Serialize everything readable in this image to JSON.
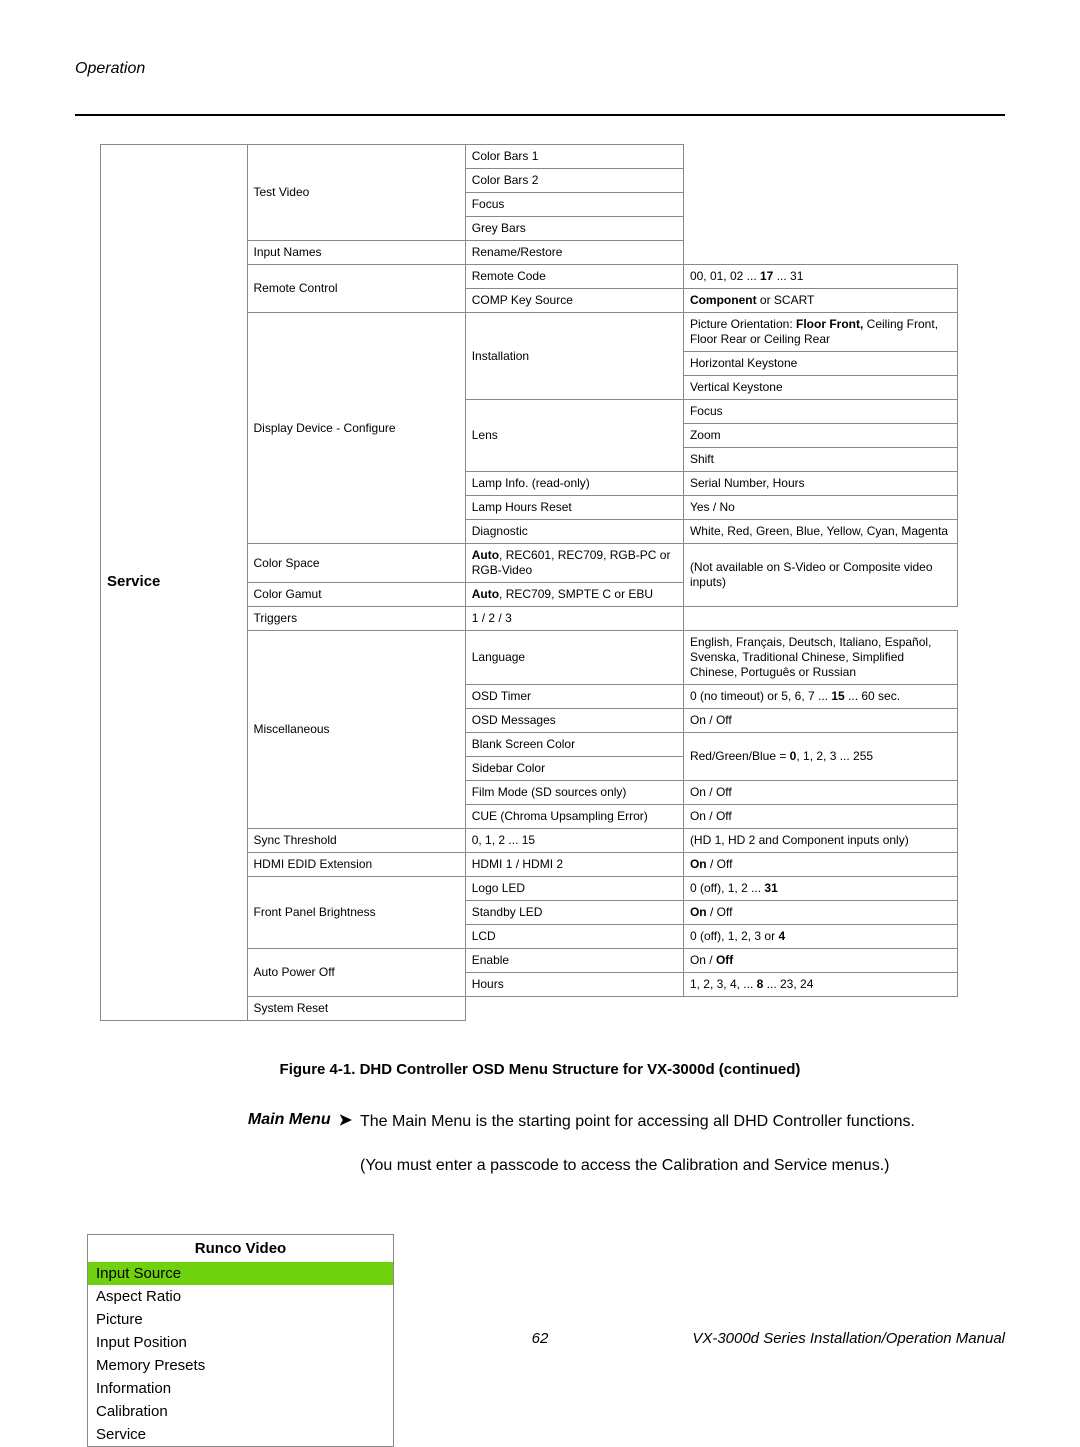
{
  "header": "Operation",
  "section": "Service",
  "table": {
    "test_video": {
      "label": "Test Video",
      "items": [
        "Color Bars 1",
        "Color Bars 2",
        "Focus",
        "Grey Bars"
      ]
    },
    "input_names": {
      "label": "Input Names",
      "val": "Rename/Restore"
    },
    "remote_control": {
      "label": "Remote Control",
      "remote_code": "Remote Code",
      "remote_code_val": "00, 01, 02 ... <b>17</b> ... 31",
      "comp_key": "COMP Key Source",
      "comp_key_val": "<b>Component</b> or SCART"
    },
    "ddc": {
      "label": "Display Device - Configure",
      "installation": {
        "label": "Installation",
        "r1": "Picture Orientation: <b>Floor Front,</b> Ceiling Front, Floor Rear or Ceiling Rear",
        "r2": "Horizontal Keystone",
        "r3": "Vertical Keystone"
      },
      "lens": {
        "label": "Lens",
        "r1": "Focus",
        "r2": "Zoom",
        "r3": "Shift"
      },
      "lamp_info": {
        "label": "Lamp Info. (read-only)",
        "val": "Serial Number, Hours"
      },
      "lamp_reset": {
        "label": "Lamp Hours Reset",
        "val": "Yes / No"
      },
      "diag": {
        "label": "Diagnostic",
        "val": "White, Red, Green, Blue, Yellow, Cyan, Magenta"
      }
    },
    "color_space": {
      "label": "Color Space",
      "val": "<b>Auto</b>, REC601, REC709, RGB-PC or RGB-Video"
    },
    "color_gamut": {
      "label": "Color Gamut",
      "val": "<b>Auto</b>, REC709, SMPTE C or EBU"
    },
    "cs_note": "(Not available on S-Video or Composite video inputs)",
    "triggers": {
      "label": "Triggers",
      "val": "1 / 2 / 3"
    },
    "misc": {
      "label": "Miscellaneous",
      "language": {
        "label": "Language",
        "val": "English, Français, Deutsch, Italiano, Español, Svenska, Traditional Chinese, Simplified Chinese, Português or Russian"
      },
      "osd_timer": {
        "label": "OSD Timer",
        "val": "0 (no timeout) or 5, 6, 7 ... <b>15</b> ... 60 sec."
      },
      "osd_msg": {
        "label": "OSD Messages",
        "val": "On / Off"
      },
      "blank": {
        "label": "Blank Screen Color"
      },
      "sidebar": {
        "label": "Sidebar Color"
      },
      "rgb_val": "Red/Green/Blue = <b>0</b>, 1, 2, 3 ... 255",
      "film": {
        "label": "Film Mode (SD sources only)",
        "val": "On / Off"
      },
      "cue": {
        "label": "CUE (Chroma Upsampling Error)",
        "val": "On / Off"
      }
    },
    "sync": {
      "label": "Sync Threshold",
      "val": "0, 1, 2 ... 15",
      "note": "(HD 1, HD 2 and Component inputs only)"
    },
    "hdmi": {
      "label": "HDMI EDID Extension",
      "val": "HDMI 1 / HDMI 2",
      "note": "<b>On</b> / Off"
    },
    "front": {
      "label": "Front Panel Brightness",
      "logo": {
        "label": "Logo LED",
        "val": "0 (off), 1, 2 ... <b>31</b>"
      },
      "standby": {
        "label": "Standby LED",
        "val": "<b>On</b> / Off"
      },
      "lcd": {
        "label": "LCD",
        "val": "0 (off), 1, 2, 3 or <b>4</b>"
      }
    },
    "auto_off": {
      "label": "Auto Power Off",
      "enable": {
        "label": "Enable",
        "val": "On / <b>Off</b>"
      },
      "hours": {
        "label": "Hours",
        "val": "1, 2, 3, 4, ... <b>8</b> ... 23, 24"
      }
    },
    "sys_reset": "System Reset"
  },
  "fig_caption": "Figure 4-1. DHD Controller OSD Menu Structure for VX-3000d (continued)",
  "main_menu": {
    "label": "Main Menu",
    "p1": "The Main Menu is the starting point for accessing all DHD Controller functions.",
    "p2": "(You must enter a passcode to access the Calibration and Service menus.)"
  },
  "menu_box": {
    "title": "Runco Video",
    "items": [
      "Input Source",
      "Aspect Ratio",
      "Picture",
      "Input Position",
      "Memory Presets",
      "Information",
      "Calibration",
      "Service"
    ],
    "selected": 0
  },
  "footer": {
    "page": "62",
    "title": "VX-3000d Series Installation/Operation Manual"
  }
}
